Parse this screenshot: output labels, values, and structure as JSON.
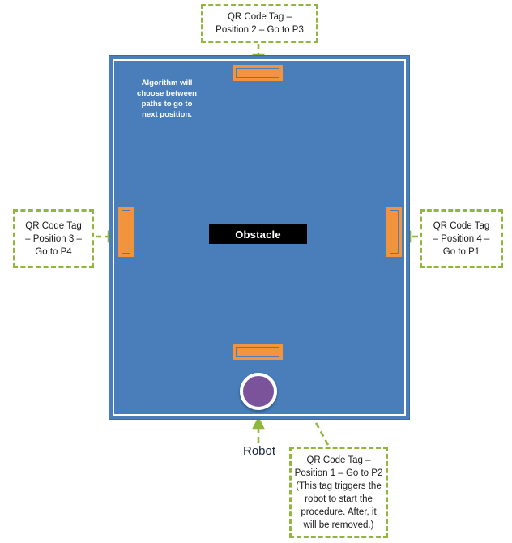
{
  "diagram": {
    "title": "Robot navigation field with QR code tags",
    "field": {
      "color": "#4A7EBB",
      "border_color": "#ffffff"
    },
    "obstacle": {
      "label": "Obstacle",
      "color": "#000000",
      "text_color": "#ffffff"
    },
    "robot": {
      "label": "Robot",
      "color": "#7A539A",
      "ring_color": "#ffffff"
    },
    "algorithm_note": {
      "line1": "Algorithm will",
      "line2": "choose between",
      "line3": "paths to go to",
      "line4": "next position."
    },
    "tags": {
      "accent_color": "#F2943D",
      "inner_border_color": "#4A7EBB",
      "top": {
        "name": "qr-tag-position-2"
      },
      "bottom": {
        "name": "qr-tag-position-1"
      },
      "left": {
        "name": "qr-tag-position-3"
      },
      "right": {
        "name": "qr-tag-position-4"
      }
    },
    "notes": {
      "accent_color": "#8FB63D",
      "position2": {
        "line1": "QR Code Tag –",
        "line2": "Position 2 – Go to P3"
      },
      "position3": {
        "line1": "QR Code Tag",
        "line2": "– Position 3 –",
        "line3": "Go to P4"
      },
      "position4": {
        "line1": "QR Code Tag",
        "line2": "– Position 4 –",
        "line3": "Go to P1"
      },
      "position1": {
        "line1": "QR Code Tag –",
        "line2": "Position 1 – Go to P2",
        "line3": "(This tag triggers the",
        "line4": "robot to start the",
        "line5": "procedure. After, it",
        "line6": "will be removed.)"
      }
    },
    "paths": {
      "color": "#000000",
      "style": "dashed",
      "description": "Two alternative dashed route loops between positions, avoiding the central obstacle"
    }
  }
}
